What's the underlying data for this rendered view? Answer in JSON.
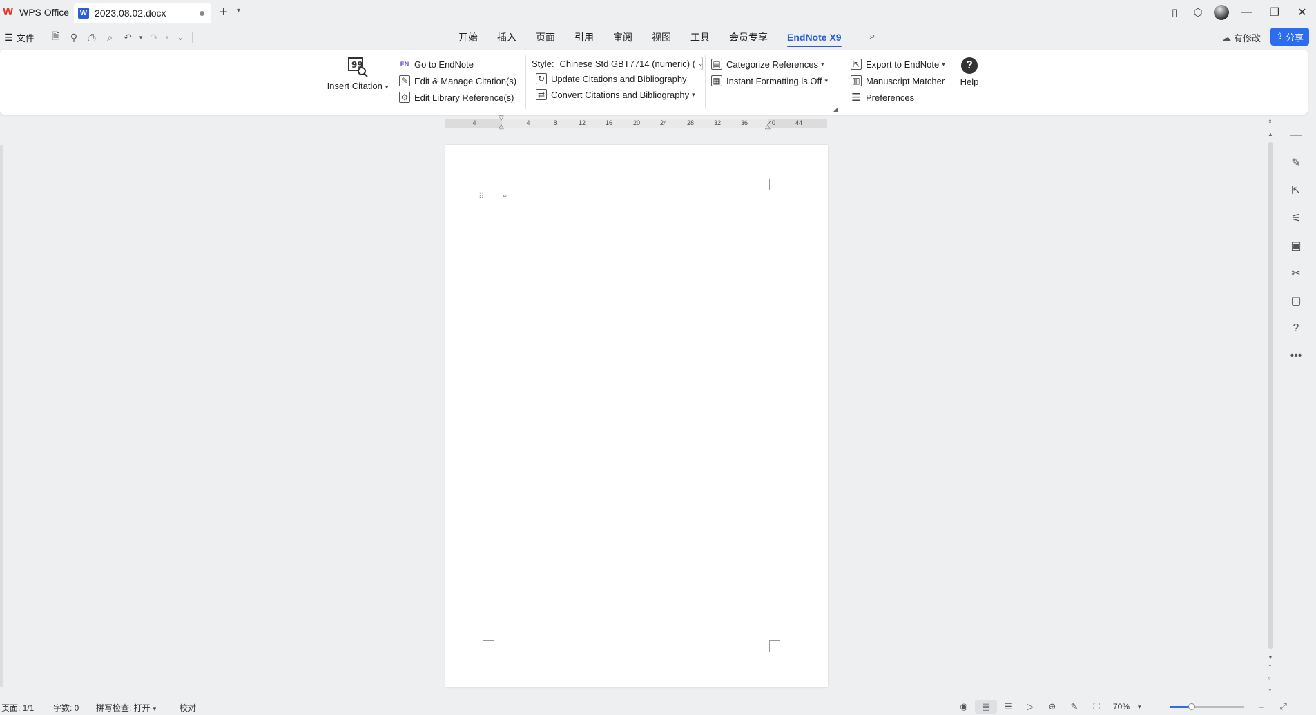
{
  "titlebar": {
    "home_tab": "WPS Office",
    "doc_tab": "2023.08.02.docx",
    "doc_icon_letter": "W"
  },
  "menubar": {
    "file_label": "文件",
    "tabs": [
      "开始",
      "插入",
      "页面",
      "引用",
      "审阅",
      "视图",
      "工具",
      "会员专享",
      "EndNote X9"
    ],
    "active_tab": "EndNote X9",
    "modify_label": "有修改",
    "share_label": "分享"
  },
  "ribbon": {
    "insert_citation": "Insert Citation",
    "go_to_endnote": "Go to EndNote",
    "edit_manage": "Edit & Manage Citation(s)",
    "edit_library": "Edit Library Reference(s)",
    "style_label": "Style:",
    "style_value": "Chinese Std GBT7714 (numeric) (",
    "update_citations": "Update Citations and Bibliography",
    "convert_citations": "Convert Citations and Bibliography",
    "categorize": "Categorize References",
    "instant_formatting": "Instant Formatting is Off",
    "export_endnote": "Export to EndNote",
    "manuscript_matcher": "Manuscript Matcher",
    "preferences": "Preferences",
    "help": "Help",
    "en_badge": "EN"
  },
  "ruler": {
    "ticks": [
      "4",
      "4",
      "8",
      "12",
      "16",
      "20",
      "24",
      "28",
      "32",
      "36",
      "40",
      "44"
    ]
  },
  "statusbar": {
    "page": "页面: 1/1",
    "words": "字数: 0",
    "spellcheck": "拼写检查: 打开",
    "proofread": "校对",
    "zoom": "70%",
    "zoom_level_fraction": 0.3
  },
  "icons": {
    "search": "search-icon",
    "accent_color": "#2b5fd9",
    "share_color": "#2b6cf0"
  }
}
